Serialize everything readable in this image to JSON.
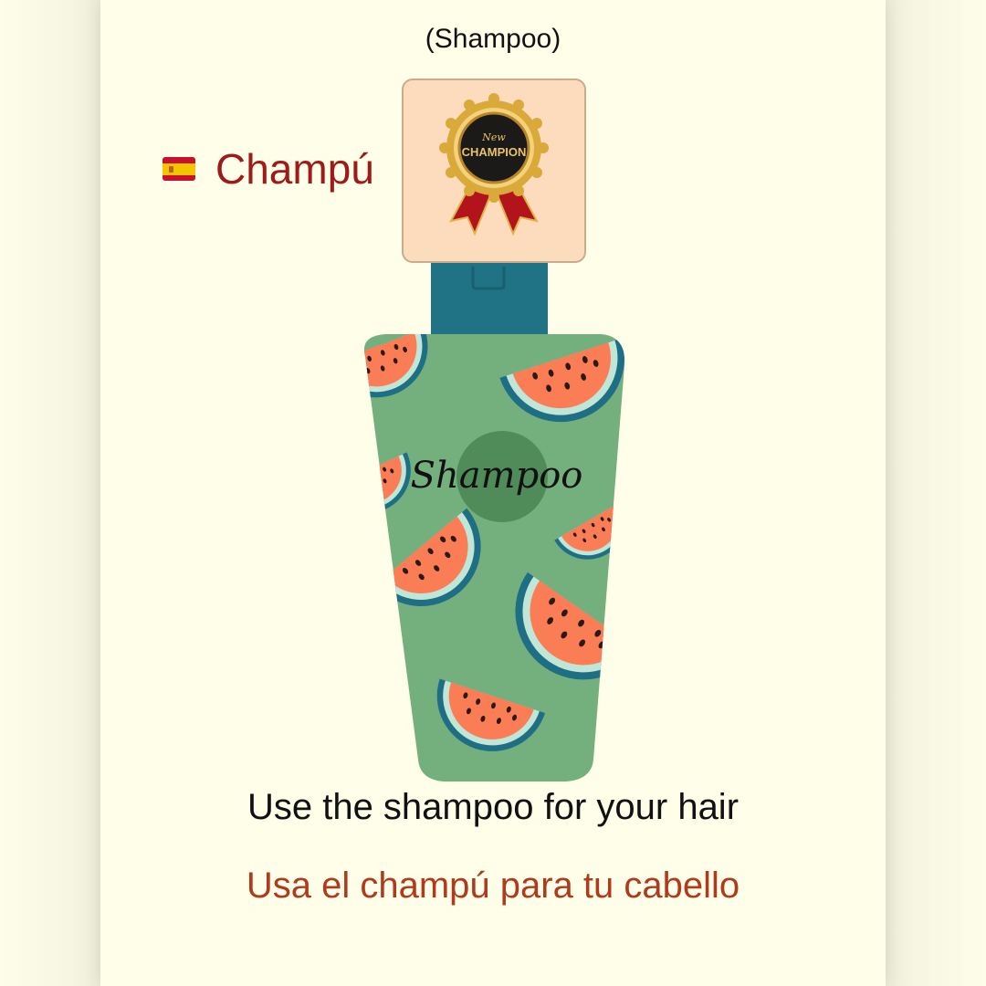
{
  "english_word": "(Shampoo)",
  "spanish_word": "Champú",
  "flag_icon": "spain-flag-icon",
  "badge": {
    "line1": "New",
    "line2": "CHAMPION",
    "icon": "award-medal-icon"
  },
  "bottle_label": "Shampoo",
  "sentence_english": "Use the shampoo for your hair",
  "sentence_spanish": "Usa el champú para tu cabello",
  "colors": {
    "background": "#fefee9",
    "spanish_word": "#9e1b1b",
    "spanish_sentence": "#b03a1e",
    "bottle_body": "#74b07e",
    "bottle_cap": "#1f7384",
    "watermelon_flesh": "#fb7d55"
  }
}
